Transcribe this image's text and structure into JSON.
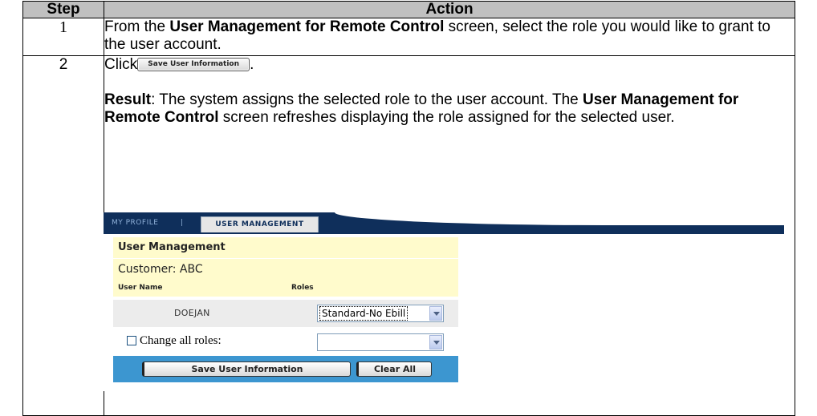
{
  "table": {
    "header_step": "Step",
    "header_action": "Action"
  },
  "row1": {
    "step": "1",
    "text_1": "From the ",
    "bold_1": "User Management for Remote Control",
    "text_2": " screen, select the role you would like to grant to the user account."
  },
  "row2": {
    "step": "2",
    "click_text": "Click",
    "inline_button": "Save User Information",
    "period": ".",
    "result_label": "Result",
    "result_text_1": ":  The system assigns the selected role to the user account.  The ",
    "result_bold": "User Management for Remote Control",
    "result_text_2": " screen refreshes displaying the role assigned for the selected user."
  },
  "screenshot": {
    "tabs": {
      "my_profile": "MY PROFILE",
      "separator": "|",
      "user_management": "USER MANAGEMENT"
    },
    "panel_title": "User Management",
    "customer": "Customer: ABC",
    "col_user_name": "User Name",
    "col_roles": "Roles",
    "user": "DOEJAN",
    "role_selected": "Standard-No Ebill",
    "change_all_label": "Change all roles:",
    "change_all_value": "",
    "save_button": "Save User Information",
    "clear_button": "Clear All"
  }
}
